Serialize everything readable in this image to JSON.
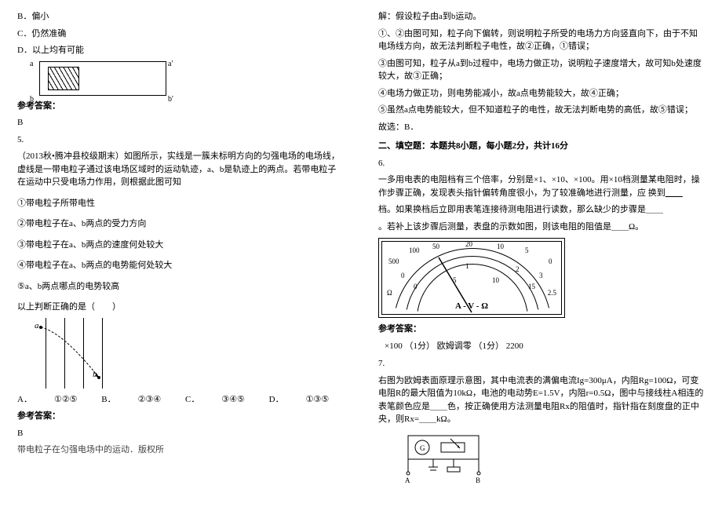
{
  "left": {
    "optB": "B．偏小",
    "optC": "C．仍然准确",
    "optD": "D．以上均有可能",
    "diag": {
      "a1": "a",
      "a2": "a'",
      "b1": "b",
      "b2": "b'"
    },
    "refAnsLabel": "参考答案：",
    "ans1": "B",
    "q5num": "5.",
    "q5text": "（2013秋•腾冲县校级期末）如图所示，实线是一簇未标明方向的匀强电场的电场线，虚线是一带电粒子通过该电场区域时的运动轨迹，a、b是轨迹上的两点。若带电粒子在运动中只受电场力作用，则根据此图可知",
    "c1": "①带电粒子所带电性",
    "c2": "②带电粒子在a、b两点的受力方向",
    "c3": "③带电粒子在a、b两点的速度何处较大",
    "c4": "④带电粒子在a、b两点的电势能何处较大",
    "c5": "⑤a、b两点哪点的电势较高",
    "choicePrompt": "以上判断正确的是（　　）",
    "fieldA": "a",
    "fieldB": "b",
    "optLineA": "A．",
    "optValA": "①②⑤",
    "optLineB": "B．",
    "optValB": "②③④",
    "optLineC": "C．",
    "optValC": "③④⑤",
    "optLineD": "D．",
    "optValD": "①③⑤",
    "ans2": "B",
    "foot": "带电粒子在匀强电场中的运动．版权所"
  },
  "right": {
    "sol1": "解：假设粒子由a到b运动。",
    "sol2": "①、②由图可知，粒子向下偏转，则说明粒子所受的电场力方向竖直向下，由于不知电场线方向，故无法判断粒子电性，故②正确，①错误；",
    "sol3": "③由图可知，粒子从a到b过程中，电场力做正功，说明粒子速度增大，故可知b处速度较大，故③正确；",
    "sol4": "④电场力做正功，则电势能减小，故a点电势能较大，故④正确；",
    "sol5": "⑤虽然a点电势能较大，但不知道粒子的电性，故无法判断电势的高低，故⑤错误；",
    "sol6": "故选：B．",
    "section2": "二、填空题：本题共8小题，每小题2分，共计16分",
    "q6num": "6.",
    "q6a": "一多用电表的电阻档有三个倍率，分别是×1、×10、×100。用×10档测量某电阻时，操作步骤正确，发现表头指针偏转角度很小，为了较准确地进行测量，应 换到",
    "q6a_blank": "＿＿",
    "q6b": "档。如果换档后立即用表笔连接待测电阻进行读数，那么缺少的步骤是＿＿",
    "q6c": "。若补上该步骤后测量，表盘的示数如图，则该电阻的阻值是＿＿Ω。",
    "meter": {
      "top_l": "500",
      "top_ml": "100",
      "top_m": "50",
      "top_mm": "20",
      "top_mr": "10",
      "top_r": "5",
      "top_rr": "0",
      "mid_l": "0",
      "mid_m": "1",
      "mid_r": "2",
      "mid_rr": "3",
      "bot_l": "0",
      "bot_m": "5",
      "bot_mm": "10",
      "bot_r": "15",
      "left_label": "Ω",
      "right_label": "2.5",
      "unit": "A - V - Ω"
    },
    "refAnsLabel": "参考答案：",
    "ans6": "×100 （1分）   欧姆调零 （1分）   2200",
    "q7num": "7.",
    "q7text1": "右图为欧姆表面原理示意图，其中电流表的满偏电流Ig=300μA，内阻Rg=100Ω，可变电阻R的最大阻值为10kΩ，电池的电动势E=1.5V，内阻r=0.5Ω，图中与接线柱A相连的表笔颜色应是＿＿色，按正确使用方法测量电阻Rx的阻值时，指针指在刻度盘的正中央，则Rx=＿＿kΩ。",
    "circ": {
      "A": "A",
      "B": "B"
    }
  }
}
